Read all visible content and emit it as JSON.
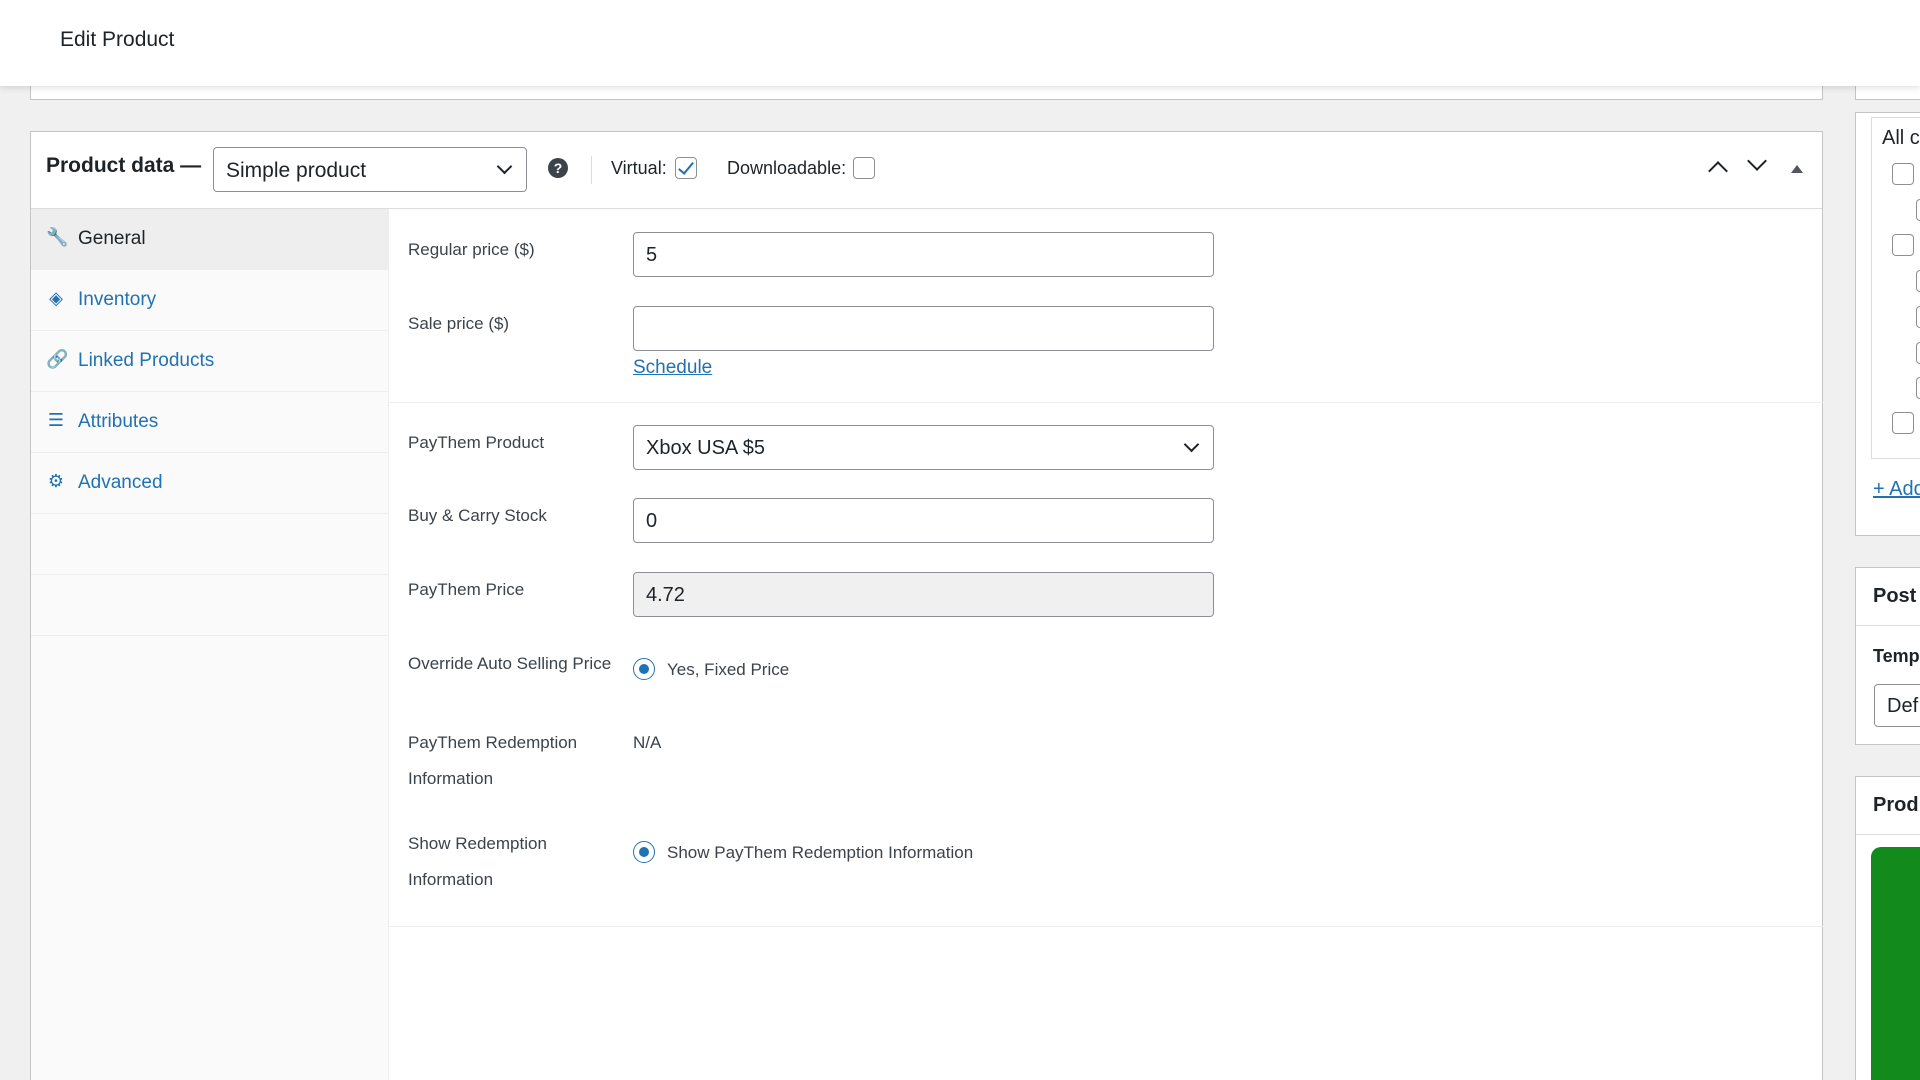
{
  "page": {
    "title": "Edit Product"
  },
  "product_data": {
    "title": "Product data —",
    "type_selected": "Simple product",
    "help_glyph": "?",
    "virtual_label": "Virtual:",
    "virtual_checked": true,
    "downloadable_label": "Downloadable:",
    "downloadable_checked": false
  },
  "tabs": [
    {
      "label": "General",
      "icon": "wrench-icon",
      "glyph": "🔧",
      "active": true
    },
    {
      "label": "Inventory",
      "icon": "tag-icon",
      "glyph": "◈",
      "active": false
    },
    {
      "label": "Linked Products",
      "icon": "link-icon",
      "glyph": "🔗",
      "active": false
    },
    {
      "label": "Attributes",
      "icon": "list-icon",
      "glyph": "☰",
      "active": false
    },
    {
      "label": "Advanced",
      "icon": "gear-icon",
      "glyph": "⚙",
      "active": false
    }
  ],
  "general": {
    "regular_price_label": "Regular price ($)",
    "regular_price_value": "5",
    "sale_price_label": "Sale price ($)",
    "sale_price_value": "",
    "schedule_link": "Schedule",
    "paythem_product_label": "PayThem Product",
    "paythem_product_value": "Xbox USA $5",
    "buy_carry_label": "Buy & Carry Stock",
    "buy_carry_value": "0",
    "paythem_price_label": "PayThem Price",
    "paythem_price_value": "4.72",
    "override_label": "Override Auto Selling Price",
    "override_option": "Yes, Fixed Price",
    "redemption_label_1": "PayThem Redemption",
    "redemption_label_2": "Information",
    "redemption_value": "N/A",
    "show_redemption_label_1": "Show Redemption",
    "show_redemption_label_2": "Information",
    "show_redemption_option": "Show PayThem Redemption Information"
  },
  "sidebar": {
    "categories_tab": "All ca",
    "add_link": "+ Add",
    "post_title": "Post",
    "template_label": "Temp",
    "template_value": "Def",
    "product_image_title": "Prod"
  },
  "colors": {
    "accent": "#2271b1",
    "image_green": "#138a1c"
  }
}
